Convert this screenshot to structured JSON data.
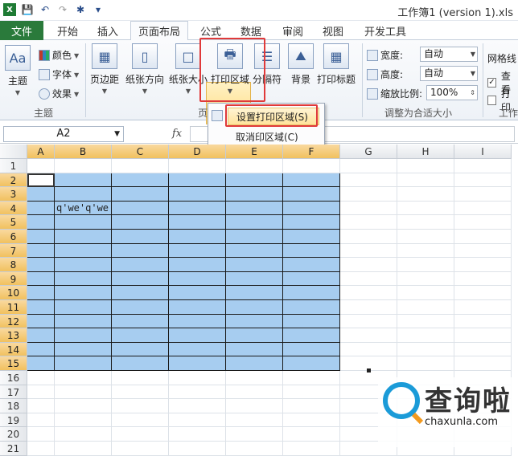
{
  "window": {
    "title": "工作簿1 (version 1).xls"
  },
  "ribbon_tabs": {
    "file": "文件",
    "home": "开始",
    "insert": "插入",
    "page_layout": "页面布局",
    "formulas": "公式",
    "data": "数据",
    "review": "审阅",
    "view": "视图",
    "developer": "开发工具"
  },
  "theme_group": {
    "themes": "主题",
    "colors": "颜色",
    "fonts": "字体",
    "effects": "效果",
    "label": "主题"
  },
  "page_setup": {
    "margins": "页边距",
    "orientation": "纸张方向",
    "size": "纸张大小",
    "print_area": "打印区域",
    "breaks": "分隔符",
    "background": "背景",
    "print_titles": "打印标题",
    "label": "页"
  },
  "scale_group": {
    "width_label": "宽度:",
    "width_value": "自动",
    "height_label": "高度:",
    "height_value": "自动",
    "scale_label": "缩放比例:",
    "scale_value": "100%",
    "label": "调整为合适大小"
  },
  "sheet_options": {
    "gridlines": "网格线",
    "view": "查看",
    "print": "打印",
    "label": "工作"
  },
  "print_area_menu": {
    "set": "设置打印区域(S)",
    "clear": "取消印区域(C)"
  },
  "formula_bar": {
    "name_box": "A2",
    "fx": "fx",
    "formula": ""
  },
  "sheet": {
    "columns": [
      "A",
      "B",
      "C",
      "D",
      "E",
      "F",
      "G",
      "H",
      "I"
    ],
    "rows": [
      "1",
      "2",
      "3",
      "4",
      "5",
      "6",
      "7",
      "8",
      "9",
      "10",
      "11",
      "12",
      "13",
      "14",
      "15",
      "16",
      "17",
      "18",
      "19",
      "20",
      "21"
    ],
    "cell_B4": "q'we'q'we"
  },
  "watermark": {
    "brand": "查询啦",
    "url": "chaxunla.com"
  }
}
